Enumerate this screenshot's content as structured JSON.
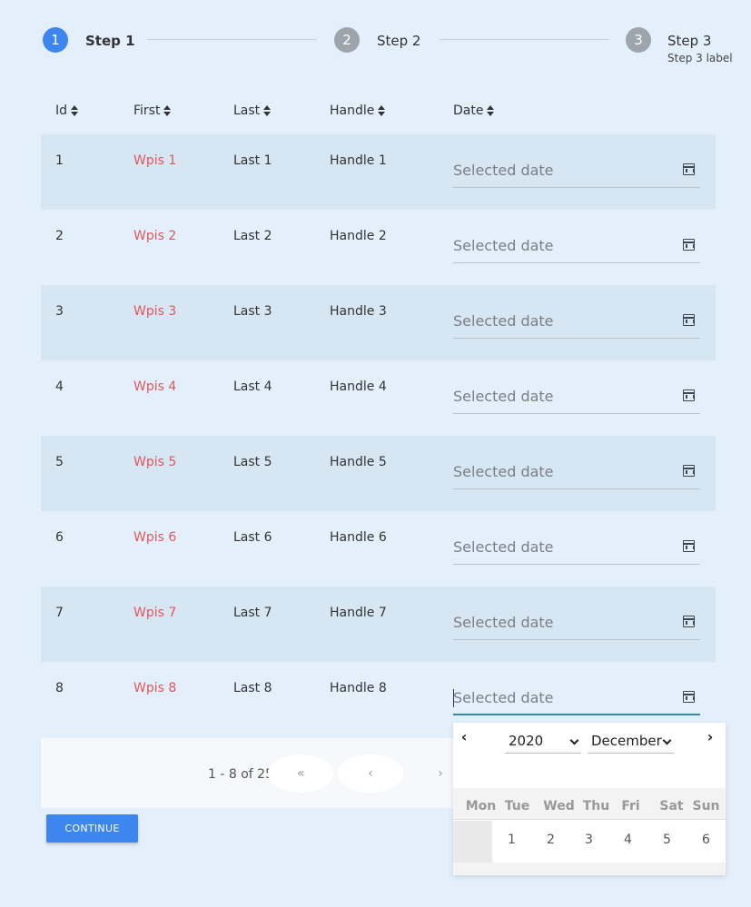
{
  "stepper": {
    "steps": [
      {
        "number": "1",
        "label": "Step 1",
        "sublabel": ""
      },
      {
        "number": "2",
        "label": "Step 2",
        "sublabel": ""
      },
      {
        "number": "3",
        "label": "Step 3",
        "sublabel": "Step 3 label"
      }
    ],
    "active_step": 1
  },
  "table": {
    "headers": [
      "Id",
      "First",
      "Last",
      "Handle",
      "Date"
    ],
    "rows": [
      {
        "id": "1",
        "first": "Wpis 1",
        "last": "Last 1",
        "handle": "Handle 1",
        "date_placeholder": "Selected date"
      },
      {
        "id": "2",
        "first": "Wpis 2",
        "last": "Last 2",
        "handle": "Handle 2",
        "date_placeholder": "Selected date"
      },
      {
        "id": "3",
        "first": "Wpis 3",
        "last": "Last 3",
        "handle": "Handle 3",
        "date_placeholder": "Selected date"
      },
      {
        "id": "4",
        "first": "Wpis 4",
        "last": "Last 4",
        "handle": "Handle 4",
        "date_placeholder": "Selected date"
      },
      {
        "id": "5",
        "first": "Wpis 5",
        "last": "Last 5",
        "handle": "Handle 5",
        "date_placeholder": "Selected date"
      },
      {
        "id": "6",
        "first": "Wpis 6",
        "last": "Last 6",
        "handle": "Handle 6",
        "date_placeholder": "Selected date"
      },
      {
        "id": "7",
        "first": "Wpis 7",
        "last": "Last 7",
        "handle": "Handle 7",
        "date_placeholder": "Selected date"
      },
      {
        "id": "8",
        "first": "Wpis 8",
        "last": "Last 8",
        "handle": "Handle 8",
        "date_placeholder": "Selected date"
      }
    ]
  },
  "pagination": {
    "info": "1 - 8 of 25",
    "first_label": "«",
    "prev_label": "‹",
    "next_label": "›"
  },
  "continue_label": "CONTINUE",
  "datepicker": {
    "prev_label": "‹",
    "next_label": "›",
    "year": "2020",
    "month": "December",
    "weekdays": [
      "Mon",
      "Tue",
      "Wed",
      "Thu",
      "Fri",
      "Sat",
      "Sun"
    ],
    "first_week": [
      "",
      "1",
      "2",
      "3",
      "4",
      "5",
      "6"
    ]
  },
  "colors": {
    "background": "#e3f0fc",
    "accent": "#3d86f0",
    "row_shade": "#d7e6f3",
    "first_name": "#e0575b",
    "focus_underline": "#3a88a9"
  }
}
